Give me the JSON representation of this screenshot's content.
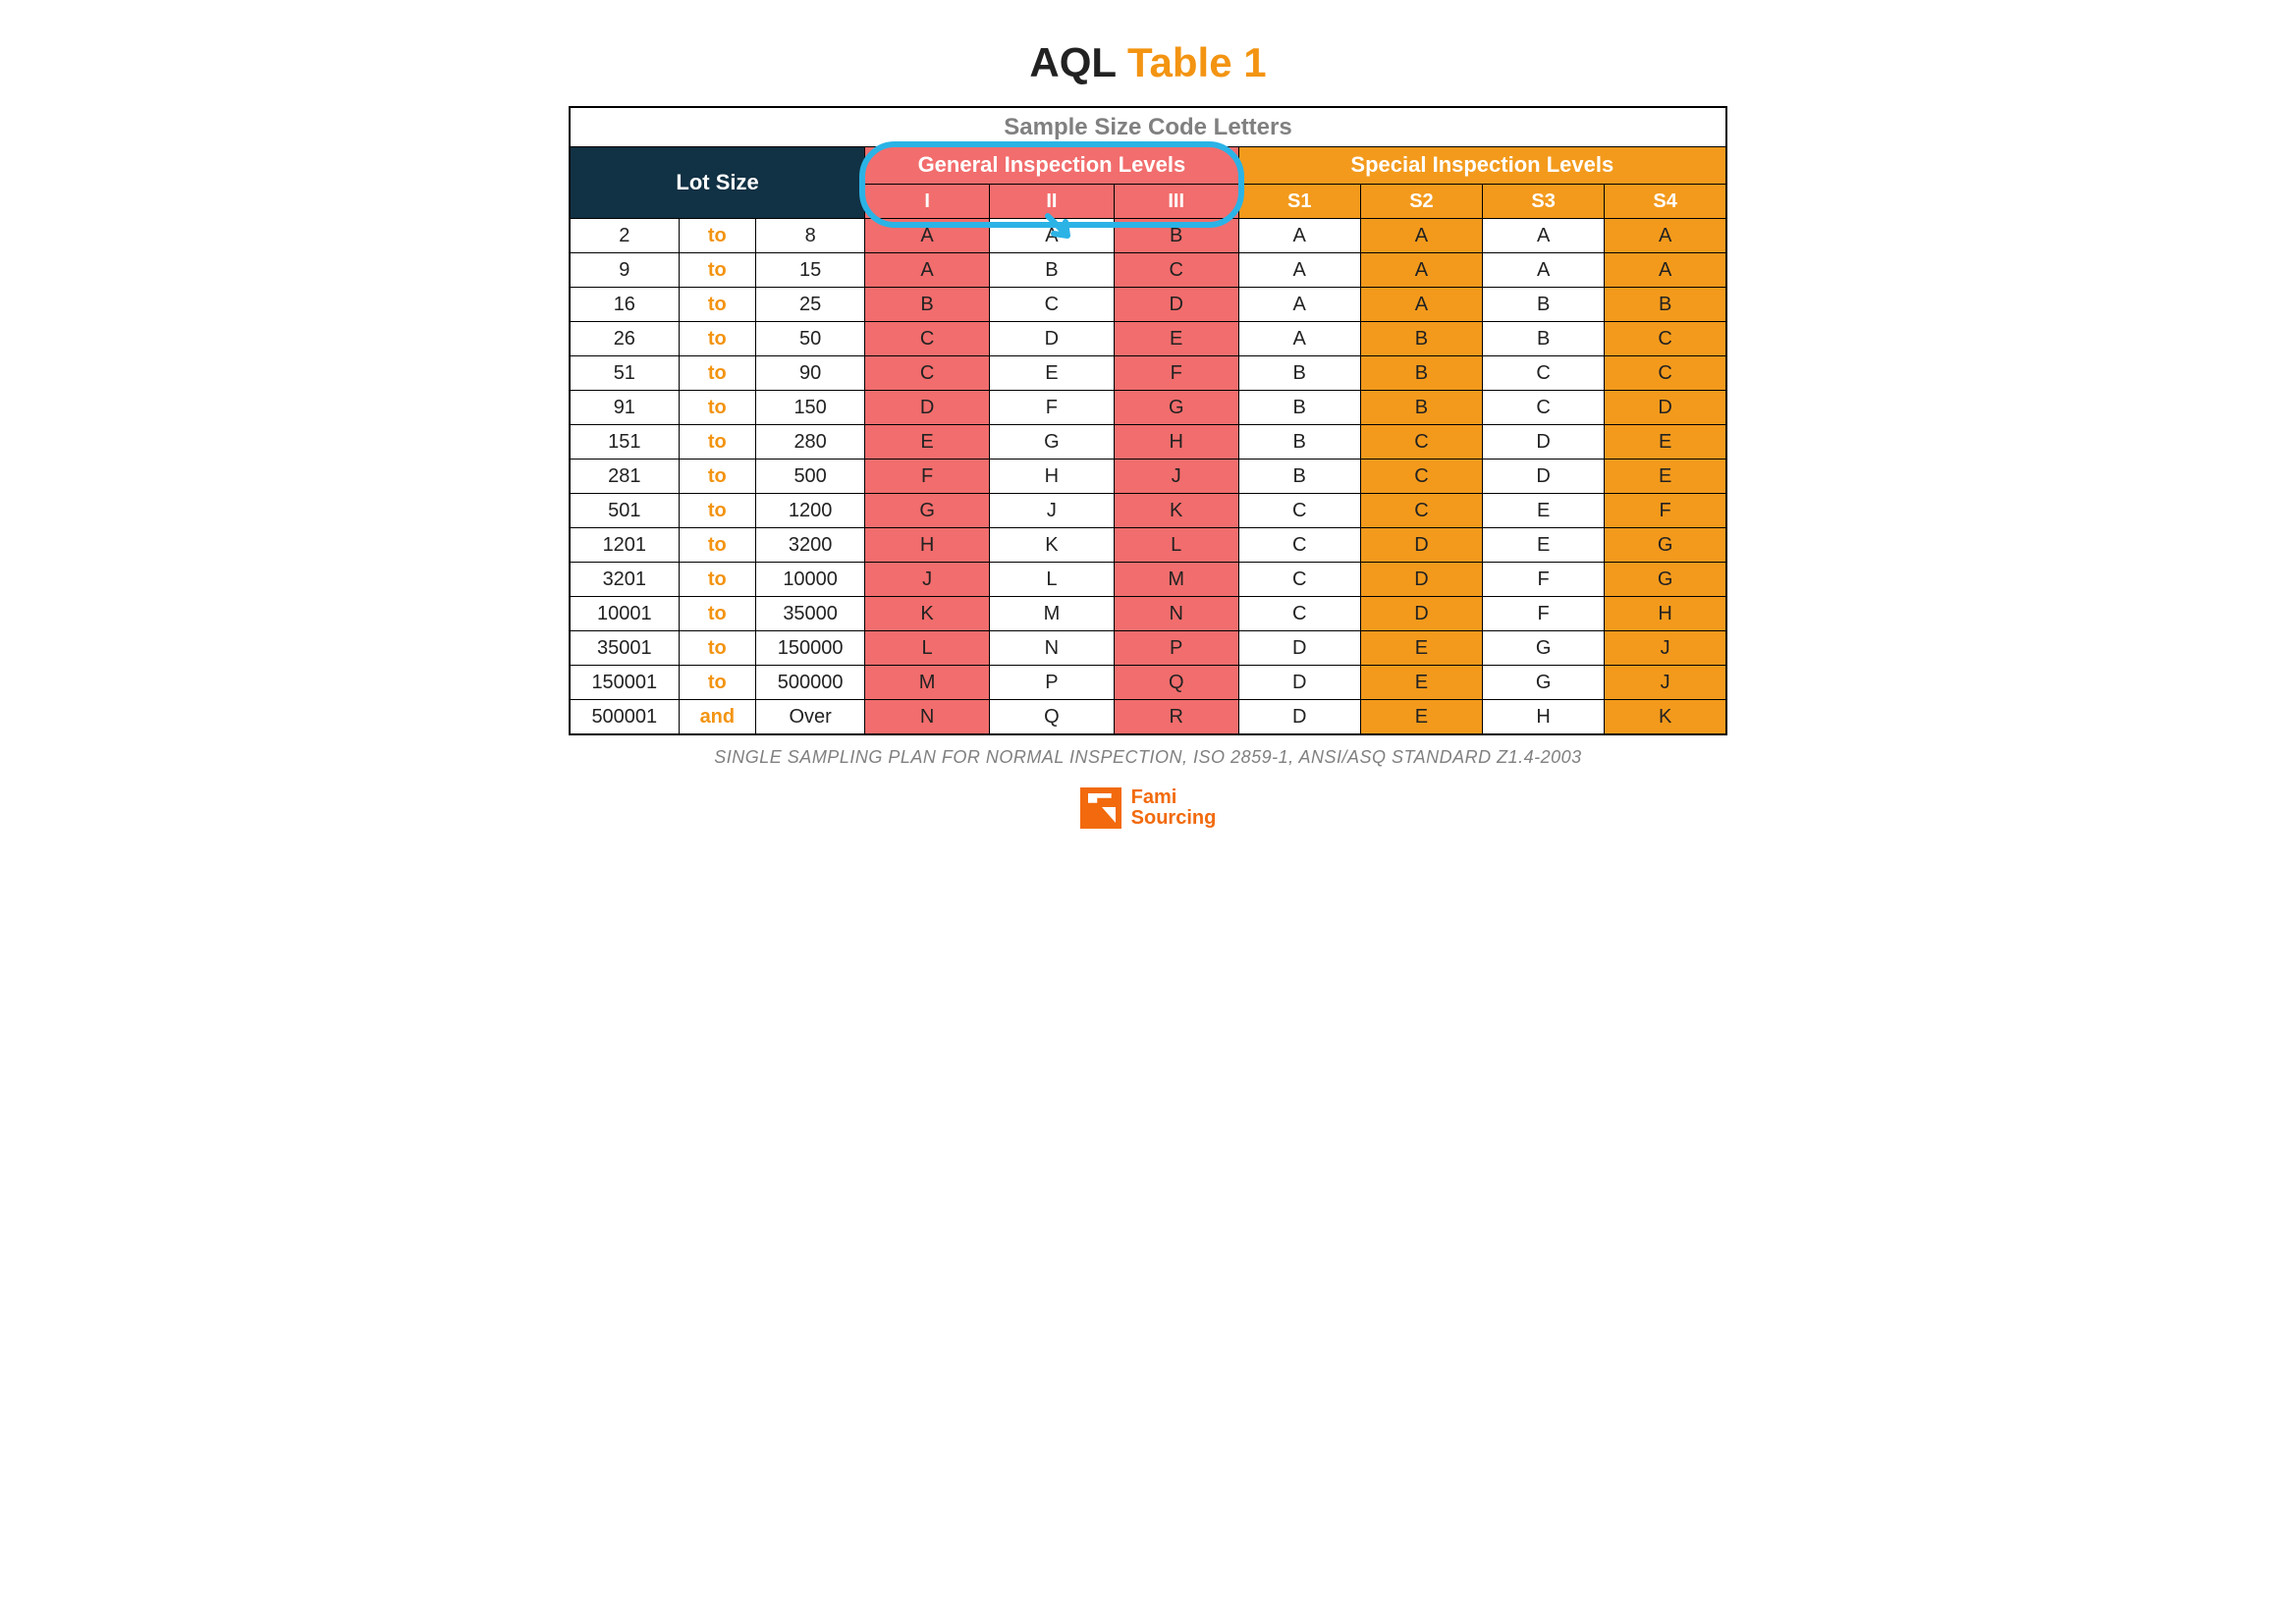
{
  "title": {
    "left": "AQL",
    "right": "Table 1"
  },
  "header_top": "Sample Size Code Letters",
  "headers": {
    "lot_size": "Lot Size",
    "general": "General Inspection Levels",
    "special": "Special Inspection Levels",
    "general_cols": [
      "I",
      "II",
      "III"
    ],
    "special_cols": [
      "S1",
      "S2",
      "S3",
      "S4"
    ]
  },
  "rows": [
    {
      "from": "2",
      "to": "to",
      "upto": "8",
      "g": [
        "A",
        "A",
        "B"
      ],
      "s": [
        "A",
        "A",
        "A",
        "A"
      ]
    },
    {
      "from": "9",
      "to": "to",
      "upto": "15",
      "g": [
        "A",
        "B",
        "C"
      ],
      "s": [
        "A",
        "A",
        "A",
        "A"
      ]
    },
    {
      "from": "16",
      "to": "to",
      "upto": "25",
      "g": [
        "B",
        "C",
        "D"
      ],
      "s": [
        "A",
        "A",
        "B",
        "B"
      ]
    },
    {
      "from": "26",
      "to": "to",
      "upto": "50",
      "g": [
        "C",
        "D",
        "E"
      ],
      "s": [
        "A",
        "B",
        "B",
        "C"
      ]
    },
    {
      "from": "51",
      "to": "to",
      "upto": "90",
      "g": [
        "C",
        "E",
        "F"
      ],
      "s": [
        "B",
        "B",
        "C",
        "C"
      ]
    },
    {
      "from": "91",
      "to": "to",
      "upto": "150",
      "g": [
        "D",
        "F",
        "G"
      ],
      "s": [
        "B",
        "B",
        "C",
        "D"
      ]
    },
    {
      "from": "151",
      "to": "to",
      "upto": "280",
      "g": [
        "E",
        "G",
        "H"
      ],
      "s": [
        "B",
        "C",
        "D",
        "E"
      ]
    },
    {
      "from": "281",
      "to": "to",
      "upto": "500",
      "g": [
        "F",
        "H",
        "J"
      ],
      "s": [
        "B",
        "C",
        "D",
        "E"
      ]
    },
    {
      "from": "501",
      "to": "to",
      "upto": "1200",
      "g": [
        "G",
        "J",
        "K"
      ],
      "s": [
        "C",
        "C",
        "E",
        "F"
      ]
    },
    {
      "from": "1201",
      "to": "to",
      "upto": "3200",
      "g": [
        "H",
        "K",
        "L"
      ],
      "s": [
        "C",
        "D",
        "E",
        "G"
      ]
    },
    {
      "from": "3201",
      "to": "to",
      "upto": "10000",
      "g": [
        "J",
        "L",
        "M"
      ],
      "s": [
        "C",
        "D",
        "F",
        "G"
      ]
    },
    {
      "from": "10001",
      "to": "to",
      "upto": "35000",
      "g": [
        "K",
        "M",
        "N"
      ],
      "s": [
        "C",
        "D",
        "F",
        "H"
      ]
    },
    {
      "from": "35001",
      "to": "to",
      "upto": "150000",
      "g": [
        "L",
        "N",
        "P"
      ],
      "s": [
        "D",
        "E",
        "G",
        "J"
      ]
    },
    {
      "from": "150001",
      "to": "to",
      "upto": "500000",
      "g": [
        "M",
        "P",
        "Q"
      ],
      "s": [
        "D",
        "E",
        "G",
        "J"
      ]
    },
    {
      "from": "500001",
      "to": "and",
      "upto": "Over",
      "g": [
        "N",
        "Q",
        "R"
      ],
      "s": [
        "D",
        "E",
        "H",
        "K"
      ]
    }
  ],
  "caption": "SINGLE SAMPLING PLAN FOR NORMAL INSPECTION, ISO 2859-1, ANSI/ASQ STANDARD Z1.4-2003",
  "logo": {
    "line1": "Fami",
    "line2": "Sourcing"
  },
  "annotation": {
    "target": "General Inspection Levels — column II highlighted"
  }
}
